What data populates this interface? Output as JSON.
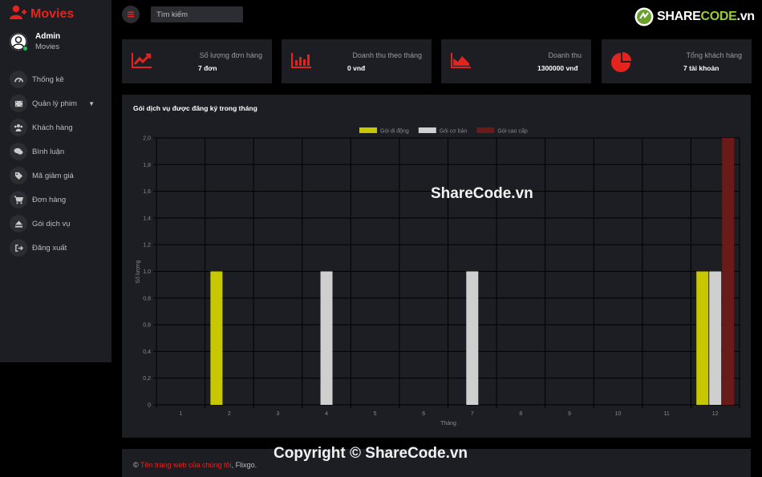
{
  "brand": {
    "name": "Movies",
    "icon": "user-icon"
  },
  "user": {
    "name": "Admin",
    "role": "Movies"
  },
  "nav": [
    {
      "label": "Thống kê",
      "icon": "dashboard-icon"
    },
    {
      "label": "Quản lý phim",
      "icon": "film-icon",
      "expandable": true
    },
    {
      "label": "Khách hàng",
      "icon": "users-icon"
    },
    {
      "label": "Bình luận",
      "icon": "comments-icon"
    },
    {
      "label": "Mã giảm giá",
      "icon": "tags-icon"
    },
    {
      "label": "Đơn hàng",
      "icon": "cart-icon"
    },
    {
      "label": "Gói dịch vụ",
      "icon": "eject-icon"
    },
    {
      "label": "Đăng xuất",
      "icon": "sign-out-icon"
    }
  ],
  "search": {
    "placeholder": "Tìm kiếm"
  },
  "logo": {
    "text_main": "SHARE",
    "text_accent": "CODE",
    "text_tail": ".vn"
  },
  "stats": [
    {
      "title": "Số lượng đơn hàng",
      "value": "7 đơn",
      "icon": "line-chart-icon"
    },
    {
      "title": "Doanh thu theo tháng",
      "value": "0 vnđ",
      "icon": "bar-chart-icon"
    },
    {
      "title": "Doanh thu",
      "value": "1300000 vnđ",
      "icon": "area-chart-icon"
    },
    {
      "title": "Tổng khách hàng",
      "value": "7 tài khoản",
      "icon": "pie-chart-icon"
    }
  ],
  "accent_color": "#e5231d",
  "panel": {
    "title": "Gói dịch vụ được đăng ký trong tháng"
  },
  "chart_data": {
    "type": "bar",
    "categories": [
      "1",
      "2",
      "3",
      "4",
      "5",
      "6",
      "7",
      "8",
      "9",
      "10",
      "11",
      "12"
    ],
    "series": [
      {
        "name": "Gói di động",
        "color": "#c8c800",
        "values": [
          0,
          1,
          0,
          0,
          0,
          0,
          0,
          0,
          0,
          0,
          0,
          1
        ]
      },
      {
        "name": "Gói cơ bản",
        "color": "#cfcfcf",
        "values": [
          0,
          0,
          0,
          1,
          0,
          0,
          1,
          0,
          0,
          0,
          0,
          1
        ]
      },
      {
        "name": "Gói cao cấp",
        "color": "#6b1a1a",
        "values": [
          0,
          0,
          0,
          0,
          0,
          0,
          0,
          0,
          0,
          0,
          0,
          2
        ]
      }
    ],
    "xlabel": "Tháng",
    "ylabel": "Số lượng",
    "ylim": [
      0,
      2
    ],
    "yticks": [
      "0",
      "0,2",
      "0,4",
      "0,6",
      "0,8",
      "1,0",
      "1,2",
      "1,4",
      "1,6",
      "1,8",
      "2,0"
    ],
    "grid": true,
    "legend": "top-center"
  },
  "watermarks": {
    "center": "ShareCode.vn",
    "bottom": "Copyright © ShareCode.vn"
  },
  "footer": {
    "prefix": "© ",
    "link": "Tên trang web của chúng tôi",
    "suffix": ", Flixgo."
  }
}
